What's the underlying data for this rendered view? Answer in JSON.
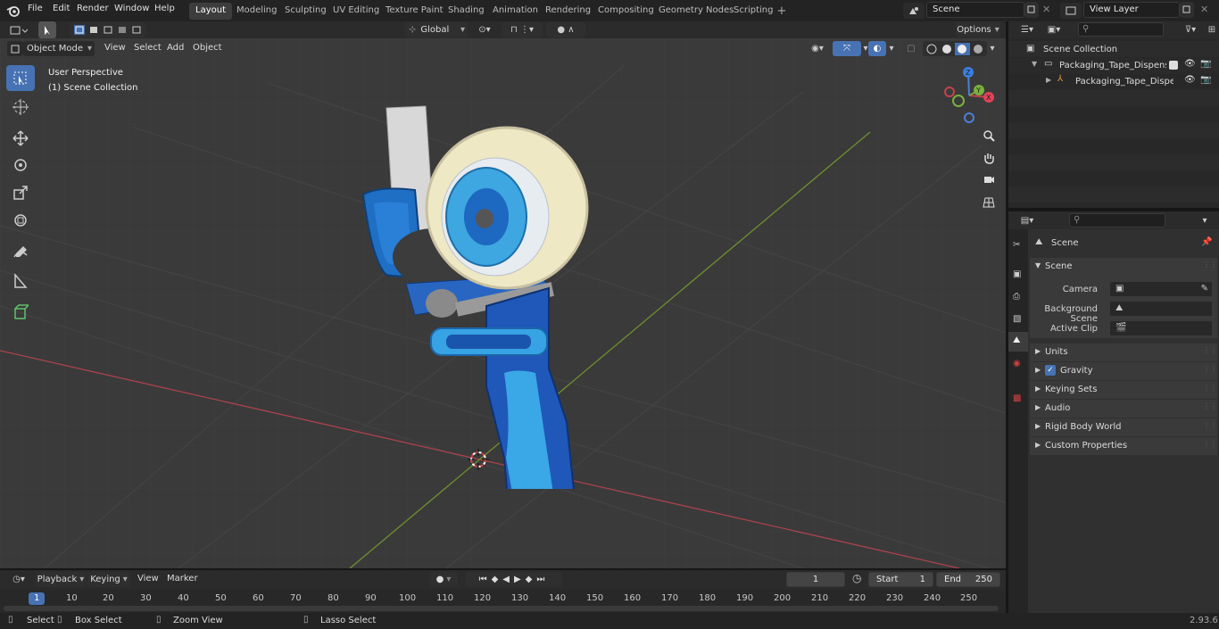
{
  "topbar": {
    "menus": [
      "File",
      "Edit",
      "Render",
      "Window",
      "Help"
    ],
    "workspaces": [
      "Layout",
      "Modeling",
      "Sculpting",
      "UV Editing",
      "Texture Paint",
      "Shading",
      "Animation",
      "Rendering",
      "Compositing",
      "Geometry Nodes",
      "Scripting"
    ],
    "active_workspace": "Layout",
    "add_tab": "+",
    "scene_name": "Scene",
    "view_layer": "View Layer"
  },
  "viewport_header": {
    "mode": "Object Mode",
    "menus": [
      "View",
      "Select",
      "Add",
      "Object"
    ],
    "transform_orientation": "Global",
    "options_label": "Options"
  },
  "viewport": {
    "perspective_label": "User Perspective",
    "collection_label": "(1) Scene Collection",
    "gizmo_axes": {
      "x": "X",
      "y": "Y",
      "z": "Z"
    }
  },
  "outliner": {
    "root": "Scene Collection",
    "items": [
      {
        "label": "Packaging_Tape_Dispenser_Y"
      },
      {
        "label": "Packaging_Tape_Dispens"
      }
    ]
  },
  "properties": {
    "context_label": "Scene",
    "panel_title": "Scene",
    "fields": [
      {
        "label": "Camera",
        "value": ""
      },
      {
        "label": "Background Scene",
        "value": ""
      },
      {
        "label": "Active Clip",
        "value": ""
      }
    ],
    "sections": [
      "Units",
      "Gravity",
      "Keying Sets",
      "Audio",
      "Rigid Body World",
      "Custom Properties"
    ]
  },
  "timeline": {
    "menus": [
      "Playback",
      "Keying",
      "View",
      "Marker"
    ],
    "current_frame": "1",
    "start_label": "Start",
    "start_value": "1",
    "end_label": "End",
    "end_value": "250",
    "ruler_ticks": [
      "1",
      "10",
      "20",
      "30",
      "40",
      "50",
      "60",
      "70",
      "80",
      "90",
      "100",
      "110",
      "120",
      "130",
      "140",
      "150",
      "160",
      "170",
      "180",
      "190",
      "200",
      "210",
      "220",
      "230",
      "240",
      "250"
    ]
  },
  "statusbar": {
    "select": "Select",
    "box_select": "Box Select",
    "zoom_view": "Zoom View",
    "lasso_select": "Lasso Select",
    "version": "2.93.6"
  },
  "colors": {
    "accent": "#4772b3",
    "viewport_bg": "#3a3a3a",
    "x_axis": "#c0444e",
    "y_axis": "#7ea13a",
    "z_axis": "#4c7fd9"
  }
}
